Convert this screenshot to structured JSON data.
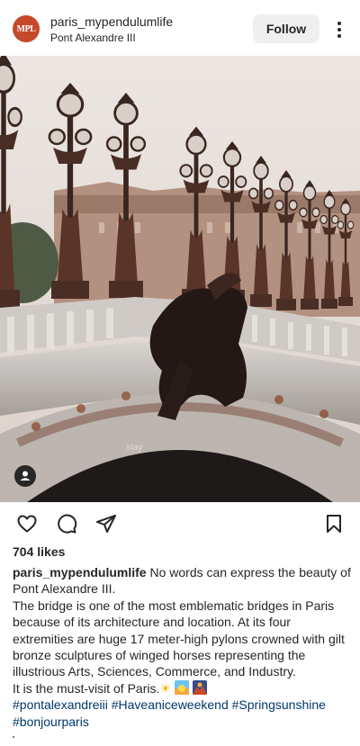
{
  "post": {
    "username": "paris_mypendulumlife",
    "location": "Pont Alexandre III",
    "follow_label": "Follow",
    "avatar_text": "MPL",
    "photo_watermark": "stay",
    "likes": "704 likes",
    "caption_intro": "No words can express the beauty of Pont Alexandre III.",
    "caption_body": "The bridge is one of the most emblematic bridges in Paris because of its architecture and location. At its four extremities are huge 17 meter-high pylons crowned with gilt bronze sculptures of winged horses representing the illustrious Arts, Sciences, Commerce, and Industry.",
    "caption_closing": "It is the must-visit of Paris.",
    "emojis": [
      "☀",
      "sunrise",
      "sunset"
    ],
    "hashtags": [
      "#pontalexandreiii",
      "#Haveaniceweekend",
      "#Springsunshine",
      "#bonjourparis"
    ]
  },
  "icons": {
    "more": "more-options-icon",
    "like": "heart-icon",
    "comment": "comment-icon",
    "share": "send-icon",
    "save": "bookmark-icon",
    "tag": "user-tag-icon"
  },
  "colors": {
    "link": "#00376b",
    "text": "#262626",
    "follow_bg": "#efefef"
  }
}
